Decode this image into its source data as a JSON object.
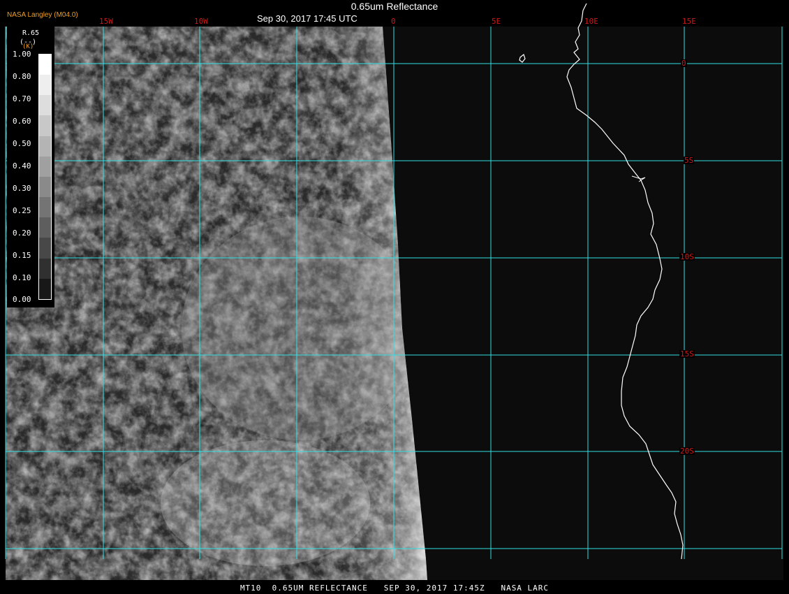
{
  "header": {
    "title": "0.65um Reflectance",
    "subtitle": "Sep 30, 2017 17:45 UTC",
    "provider": "NASA Langley (M04.0)"
  },
  "footer": {
    "caption": "MT10  0.65UM REFLECTANCE   SEP 30, 2017 17:45Z   NASA LARC"
  },
  "legend": {
    "title": "R.65",
    "unit": "(--)",
    "unit_k": "(K)",
    "ticks": [
      "1.00",
      "0.80",
      "0.70",
      "0.60",
      "0.50",
      "0.40",
      "0.30",
      "0.25",
      "0.20",
      "0.15",
      "0.10",
      "0.00"
    ],
    "colors": [
      "#ffffff",
      "#eeeeee",
      "#dddddd",
      "#c8c8c8",
      "#b4b4b4",
      "#a0a0a0",
      "#8a8a8a",
      "#747474",
      "#5e5e5e",
      "#484848",
      "#303030",
      "#181818"
    ]
  },
  "grid": {
    "longitudes": [
      "15W",
      "10W",
      "0",
      "5E",
      "10E",
      "15E"
    ],
    "latitudes": [
      "0",
      "5S",
      "10S",
      "15S",
      "20S"
    ],
    "color": "#30e0e0"
  },
  "colors": {
    "label": "#d01818",
    "coastline": "#ffffff",
    "provider": "#f0a020"
  }
}
